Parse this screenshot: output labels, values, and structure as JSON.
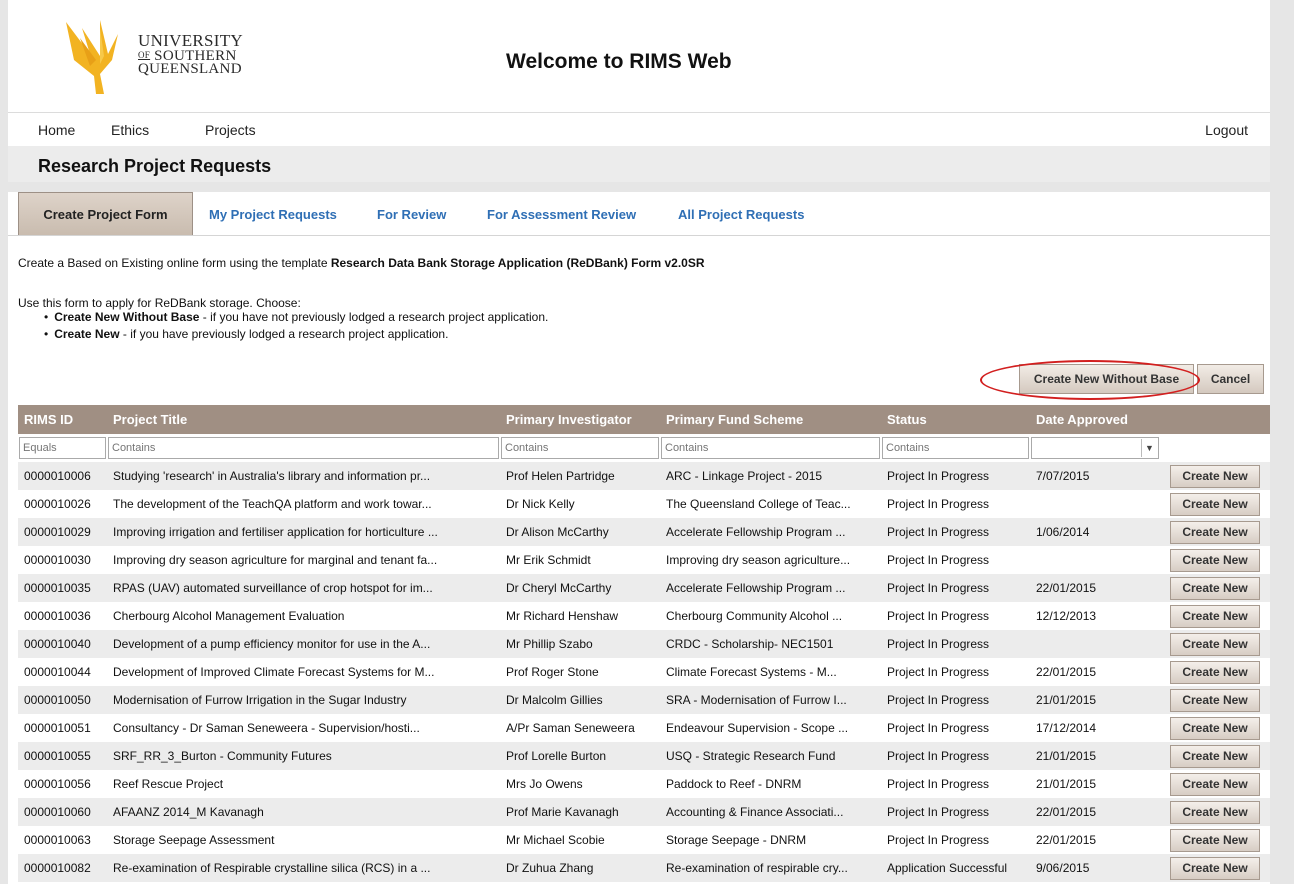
{
  "header": {
    "logo_lines": [
      "UNIVERSITY",
      "OF",
      "SOUTHERN",
      "QUEENSLAND"
    ],
    "title": "Welcome to RIMS Web"
  },
  "nav": {
    "home": "Home",
    "ethics": "Ethics",
    "projects": "Projects",
    "logout": "Logout"
  },
  "page_heading": "Research Project Requests",
  "tabs": [
    {
      "label": "Create Project Form",
      "active": true
    },
    {
      "label": "My Project Requests"
    },
    {
      "label": "For Review"
    },
    {
      "label": "For Assessment Review"
    },
    {
      "label": "All Project Requests"
    }
  ],
  "intro": {
    "prefix": "Create a Based on Existing online form using the template ",
    "template_name": "Research Data Bank Storage Application (ReDBank) Form v2.0SR",
    "instruction": "Use this form to apply for ReDBank storage. Choose:",
    "bullets": [
      {
        "bold": "Create New Without Base",
        "text": " - if you have not previously lodged a research project application."
      },
      {
        "bold": "Create New",
        "text": " - if you have previously lodged a research project application."
      }
    ]
  },
  "actions": {
    "create_without_base": "Create New Without Base",
    "cancel": "Cancel"
  },
  "table": {
    "columns": [
      "RIMS ID",
      "Project Title",
      "Primary Investigator",
      "Primary Fund Scheme",
      "Status",
      "Date Approved"
    ],
    "filters": [
      "Equals",
      "Contains",
      "Contains",
      "Contains",
      "Contains",
      ""
    ],
    "row_button": "Create New",
    "rows": [
      [
        "0000010006",
        "Studying 'research' in Australia's library and information pr...",
        "Prof Helen Partridge",
        "ARC - Linkage Project - 2015",
        "Project In Progress",
        "7/07/2015"
      ],
      [
        "0000010026",
        "The development of the TeachQA platform and work towar...",
        "Dr Nick Kelly",
        "The Queensland College of Teac...",
        "Project In Progress",
        ""
      ],
      [
        "0000010029",
        "Improving irrigation and fertiliser application for horticulture ...",
        "Dr Alison McCarthy",
        "Accelerate Fellowship Program ...",
        "Project In Progress",
        "1/06/2014"
      ],
      [
        "0000010030",
        "Improving dry season agriculture for marginal and tenant fa...",
        "Mr Erik Schmidt",
        "Improving dry season agriculture...",
        "Project In Progress",
        ""
      ],
      [
        "0000010035",
        "RPAS (UAV) automated surveillance of crop hotspot for im...",
        "Dr Cheryl McCarthy",
        "Accelerate Fellowship Program ...",
        "Project In Progress",
        "22/01/2015"
      ],
      [
        "0000010036",
        "Cherbourg Alcohol Management Evaluation",
        "Mr Richard Henshaw",
        "Cherbourg Community Alcohol ...",
        "Project In Progress",
        "12/12/2013"
      ],
      [
        "0000010040",
        "Development of a pump efficiency monitor for use in the A...",
        "Mr Phillip Szabo",
        "CRDC - Scholarship- NEC1501",
        "Project In Progress",
        ""
      ],
      [
        "0000010044",
        "Development of Improved Climate Forecast Systems for M...",
        "Prof Roger Stone",
        "Climate Forecast Systems - M...",
        "Project In Progress",
        "22/01/2015"
      ],
      [
        "0000010050",
        "Modernisation of Furrow Irrigation in the Sugar Industry",
        "Dr Malcolm Gillies",
        "SRA - Modernisation of Furrow I...",
        "Project In Progress",
        "21/01/2015"
      ],
      [
        "0000010051",
        "Consultancy  -  Dr Saman Seneweera  -  Supervision/hosti...",
        "A/Pr Saman Seneweera",
        "Endeavour Supervision - Scope ...",
        "Project In Progress",
        "17/12/2014"
      ],
      [
        "0000010055",
        "SRF_RR_3_Burton - Community Futures",
        "Prof Lorelle Burton",
        "USQ - Strategic Research Fund",
        "Project In Progress",
        "21/01/2015"
      ],
      [
        "0000010056",
        "Reef Rescue Project",
        "Mrs Jo Owens",
        "Paddock to Reef - DNRM",
        "Project In Progress",
        "21/01/2015"
      ],
      [
        "0000010060",
        "AFAANZ 2014_M Kavanagh",
        "Prof Marie Kavanagh",
        "Accounting & Finance Associati...",
        "Project In Progress",
        "22/01/2015"
      ],
      [
        "0000010063",
        "Storage Seepage Assessment",
        "Mr Michael Scobie",
        "Storage Seepage - DNRM",
        "Project In Progress",
        "22/01/2015"
      ],
      [
        "0000010082",
        "Re-examination of Respirable crystalline silica (RCS) in a ...",
        "Dr Zuhua Zhang",
        "Re-examination of respirable cry...",
        "Application Successful",
        "9/06/2015"
      ]
    ]
  }
}
